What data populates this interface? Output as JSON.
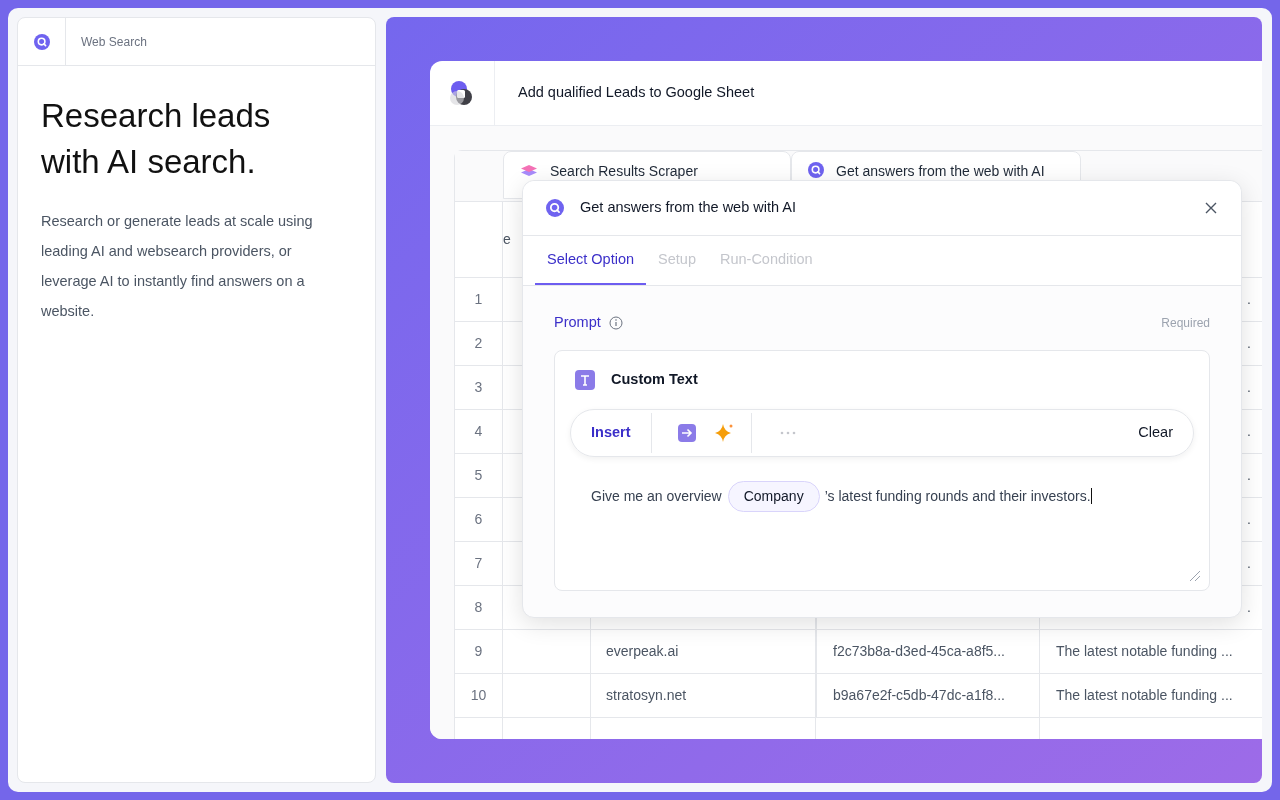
{
  "sidebar": {
    "title": "Web Search",
    "heading": "Research leads with AI search.",
    "description": "Research or generate leads at scale using leading AI and websearch providers, or leverage AI to instantly find answers on a website."
  },
  "workflow": {
    "title": "Add qualified Leads to Google Sheet",
    "column_headers": [
      {
        "label": "Search Results Scraper",
        "kind": "scraper"
      },
      {
        "label": "Get answers from the web with AI",
        "kind": "search"
      }
    ],
    "column_fragment": "e",
    "rows": [
      {
        "number": "1",
        "column_5": "."
      },
      {
        "number": "2",
        "column_5": "."
      },
      {
        "number": "3",
        "column_5": "."
      },
      {
        "number": "4",
        "column_5": "."
      },
      {
        "number": "5",
        "column_5": "."
      },
      {
        "number": "6",
        "column_5": "."
      },
      {
        "number": "7",
        "column_5": "."
      },
      {
        "number": "8",
        "column_5": "."
      },
      {
        "number": "9",
        "domain": "everpeak.ai",
        "id": "f2c73b8a-d3ed-45ca-a8f5...",
        "column_5": "The latest notable funding ..."
      },
      {
        "number": "10",
        "domain": "stratosyn.net",
        "id": "b9a67e2f-c5db-47dc-a1f8...",
        "column_5": "The latest notable funding ..."
      }
    ]
  },
  "modal": {
    "title": "Get answers from the web with AI",
    "tabs": [
      {
        "label": "Select Option",
        "selected": true
      },
      {
        "label": "Setup",
        "selected": false
      },
      {
        "label": "Run-Condition",
        "selected": false
      }
    ],
    "prompt": {
      "label": "Prompt",
      "required": "Required",
      "source": "Custom Text",
      "insert": "Insert",
      "clear": "Clear",
      "text_before": "Give me an overview",
      "token": "Company",
      "text_after": "’s latest funding rounds and their investors."
    }
  }
}
